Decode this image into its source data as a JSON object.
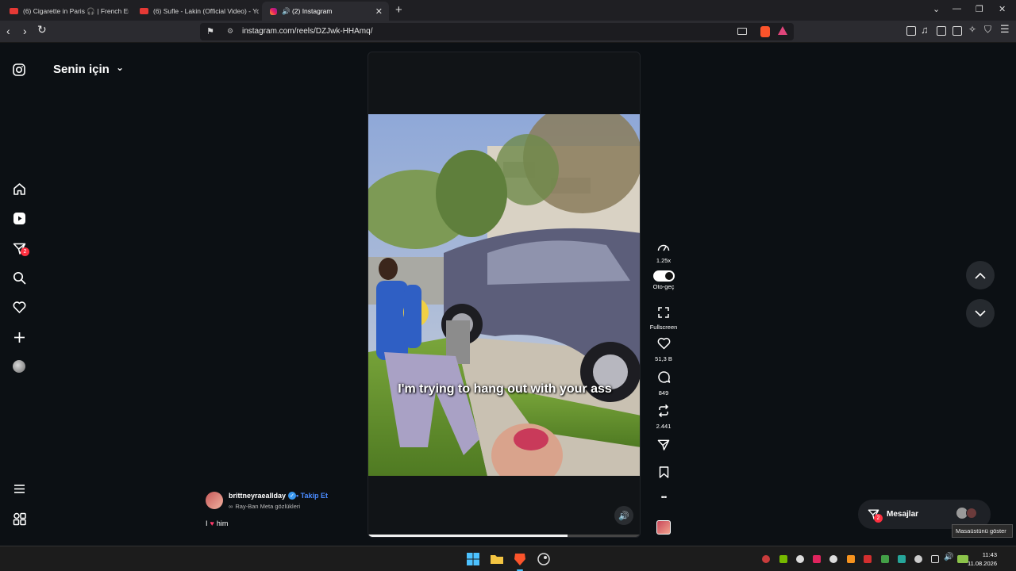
{
  "browser": {
    "tabs": [
      {
        "label": "(6) Cigarette in Paris 🎧 | French Emo"
      },
      {
        "label": "(6) Sufle - Lakin (Official Video) - You"
      },
      {
        "label": "🔊 (2) Instagram"
      }
    ],
    "new_tab": "+",
    "url": "instagram.com/reels/DZJwk-HHAmq/"
  },
  "sidebar": {
    "feed_title": "Senin için",
    "dropdown_glyph": "⌄",
    "messages_badge": "2",
    "items": [
      {
        "icon": "home-icon"
      },
      {
        "icon": "reels-icon"
      },
      {
        "icon": "direct-icon"
      },
      {
        "icon": "search-icon"
      },
      {
        "icon": "heart-icon"
      },
      {
        "icon": "create-icon"
      },
      {
        "icon": "profile-icon"
      }
    ]
  },
  "reel": {
    "caption": "I'm trying to hang out with your ass",
    "progress_fraction": 0.73,
    "author": "brittneyraeallday",
    "follow_sep": "•",
    "follow_label": "Takip Et",
    "product": "Ray-Ban Meta gözlükleri",
    "description_before": "I",
    "description_after": "him"
  },
  "actions": {
    "speed": "1.25x",
    "autoplay": "Oto-geç",
    "fullscreen": "Fullscreen",
    "likes": "51,3 B",
    "comments": "849",
    "reposts": "2.441",
    "more": "•••"
  },
  "messages": {
    "label": "Mesajlar",
    "badge": "2",
    "tooltip": "Masaüstünü göster"
  },
  "taskbar": {
    "time": "11:43",
    "date": "11.08.2026"
  },
  "colors": {
    "background": "#0c1014",
    "badge_red": "#ff3040",
    "follow_blue": "#4a8bff",
    "verified_blue": "#3897f0"
  }
}
